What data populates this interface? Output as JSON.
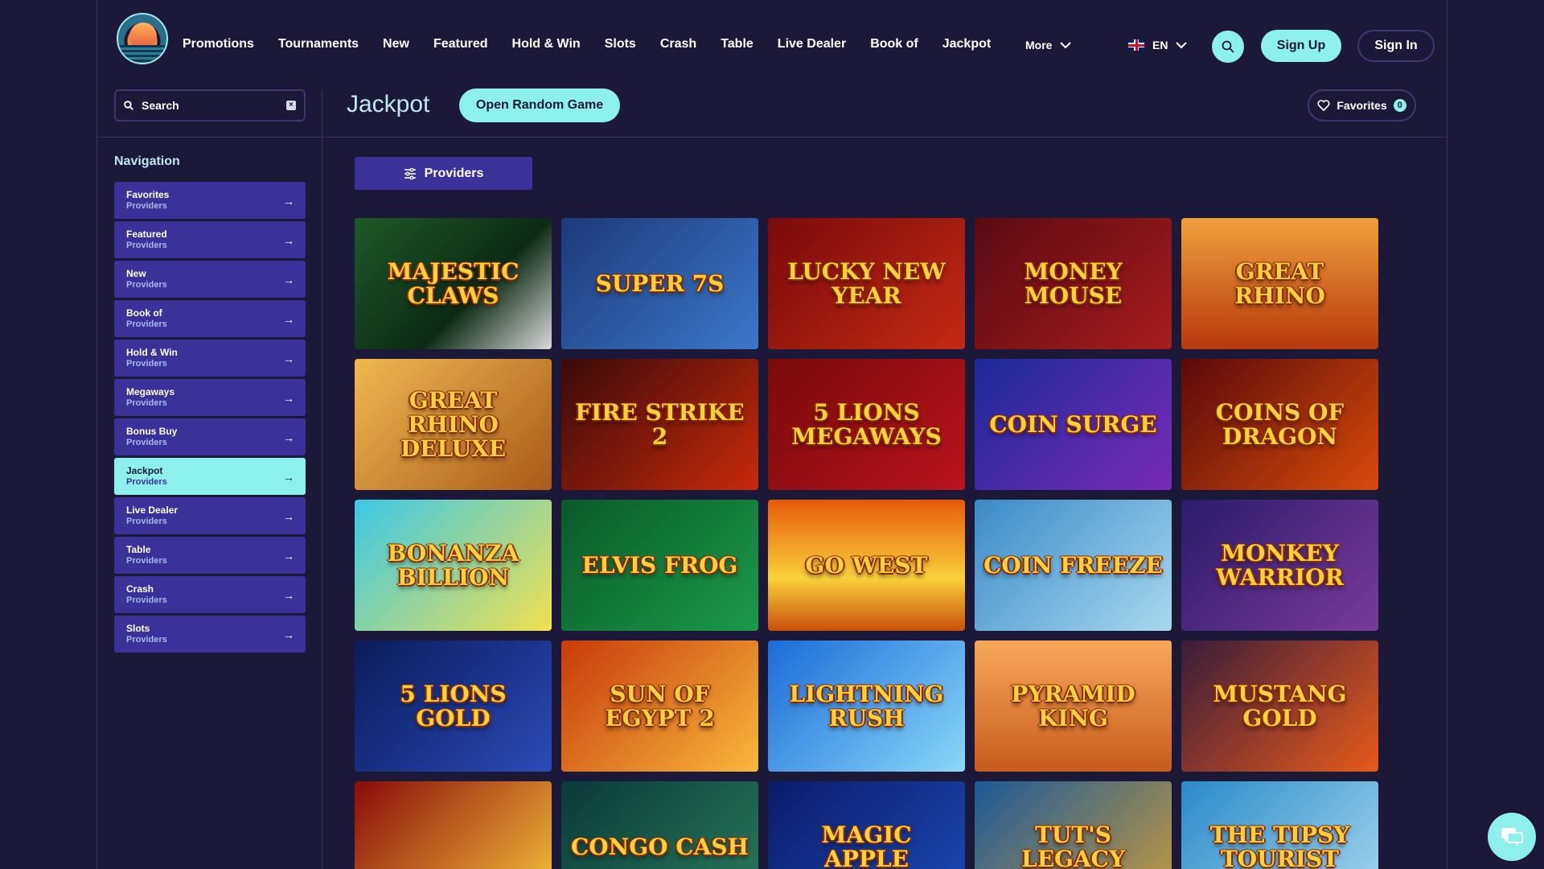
{
  "header": {
    "nav": [
      "Promotions",
      "Tournaments",
      "New",
      "Featured",
      "Hold & Win",
      "Slots",
      "Crash",
      "Table",
      "Live Dealer",
      "Book of",
      "Jackpot"
    ],
    "more_label": "More",
    "lang_label": "EN",
    "signup_label": "Sign Up",
    "signin_label": "Sign In"
  },
  "sidebar": {
    "search_placeholder": "Search",
    "nav_title": "Navigation",
    "items": [
      {
        "title": "Favorites",
        "sub": "Providers"
      },
      {
        "title": "Featured",
        "sub": "Providers"
      },
      {
        "title": "New",
        "sub": "Providers"
      },
      {
        "title": "Book of",
        "sub": "Providers"
      },
      {
        "title": "Hold & Win",
        "sub": "Providers"
      },
      {
        "title": "Megaways",
        "sub": "Providers"
      },
      {
        "title": "Bonus Buy",
        "sub": "Providers"
      },
      {
        "title": "Jackpot",
        "sub": "Providers",
        "active": true
      },
      {
        "title": "Live Dealer",
        "sub": "Providers"
      },
      {
        "title": "Table",
        "sub": "Providers"
      },
      {
        "title": "Crash",
        "sub": "Providers"
      },
      {
        "title": "Slots",
        "sub": "Providers"
      }
    ]
  },
  "main": {
    "title": "Jackpot",
    "random_label": "Open Random Game",
    "favorites_label": "Favorites",
    "favorites_count": "0",
    "providers_label": "Providers",
    "games": [
      {
        "name": "Majestic Claws",
        "bg": "linear-gradient(135deg,#1d5a2a,#0d2a14 60%,#d9d9d9)"
      },
      {
        "name": "Super 7s",
        "bg": "linear-gradient(135deg,#1c3a7a,#3c78c8)"
      },
      {
        "name": "Lucky New Year",
        "bg": "linear-gradient(135deg,#7a0a0a,#c42a14)"
      },
      {
        "name": "Money Mouse",
        "bg": "linear-gradient(135deg,#5a0a14,#a81c1c)"
      },
      {
        "name": "Great Rhino",
        "bg": "linear-gradient(180deg,#f0a03c,#b8380c)"
      },
      {
        "name": "Great Rhino Deluxe",
        "bg": "linear-gradient(135deg,#f0b850,#a85a1a)"
      },
      {
        "name": "Fire Strike 2",
        "bg": "linear-gradient(135deg,#3a0a0a,#c82a0a)"
      },
      {
        "name": "5 Lions Megaways",
        "bg": "linear-gradient(135deg,#7a0a0a,#b8141c)"
      },
      {
        "name": "Coin Surge",
        "bg": "linear-gradient(135deg,#1c2a9a,#7a2ab8)"
      },
      {
        "name": "Coins of Dragon",
        "bg": "linear-gradient(135deg,#5a0a0a,#d84a0a)"
      },
      {
        "name": "Bonanza Billion",
        "bg": "linear-gradient(135deg,#3ac8e8,#f0e050)"
      },
      {
        "name": "Elvis Frog",
        "bg": "linear-gradient(135deg,#0a5a2a,#1c9a4a)"
      },
      {
        "name": "Go West",
        "bg": "linear-gradient(180deg,#e85a0a,#f8d03c 60%,#c8500a)"
      },
      {
        "name": "Coin Freeze",
        "bg": "linear-gradient(135deg,#3a8ac8,#a8d8f0)"
      },
      {
        "name": "Monkey Warrior",
        "bg": "linear-gradient(135deg,#2a1c6a,#7a3a9a)"
      },
      {
        "name": "5 Lions Gold",
        "bg": "linear-gradient(135deg,#0a1c5a,#2a4ab8)"
      },
      {
        "name": "Sun of Egypt 2",
        "bg": "linear-gradient(135deg,#c83a0a,#f8b83c)"
      },
      {
        "name": "Lightning Rush",
        "bg": "linear-gradient(135deg,#1c6ad8,#8ad8f8)"
      },
      {
        "name": "Pyramid King",
        "bg": "linear-gradient(180deg,#f8a85a,#c85a1c)"
      },
      {
        "name": "Mustang Gold",
        "bg": "linear-gradient(135deg,#3a1c3a,#e85a1c)"
      },
      {
        "name": "",
        "bg": "linear-gradient(135deg,#8a0a0a,#f8c83c)"
      },
      {
        "name": "Congo Cash",
        "bg": "linear-gradient(135deg,#0a3a3a,#2a7a5a)"
      },
      {
        "name": "Magic Apple",
        "bg": "linear-gradient(135deg,#0a1c6a,#1c4ab8)"
      },
      {
        "name": "Tut's Legacy",
        "bg": "linear-gradient(135deg,#1c5a9a,#c89a3a)"
      },
      {
        "name": "The Tipsy Tourist",
        "bg": "linear-gradient(135deg,#2a8ac8,#a8d8f0)"
      }
    ]
  }
}
